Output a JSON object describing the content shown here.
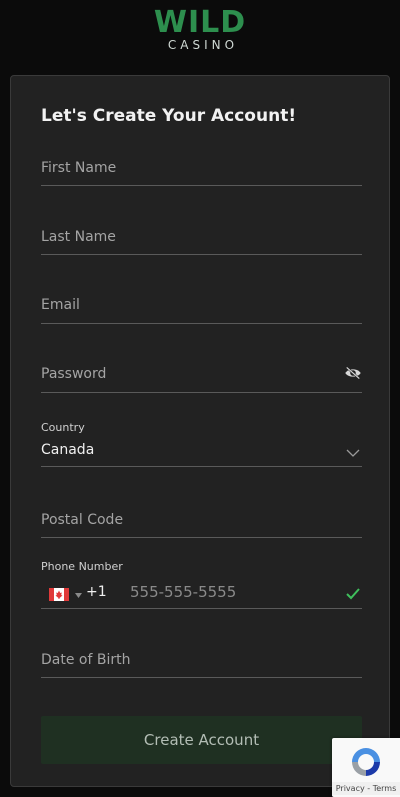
{
  "brand": {
    "name": "WILD",
    "sub": "CASINO",
    "color": "#2d8f4e"
  },
  "form": {
    "title": "Let's Create Your Account!",
    "first_name_placeholder": "First Name",
    "last_name_placeholder": "Last Name",
    "email_placeholder": "Email",
    "password_placeholder": "Password",
    "country_label": "Country",
    "country_value": "Canada",
    "postal_placeholder": "Postal Code",
    "phone_label": "Phone Number",
    "phone_code": "+1",
    "phone_placeholder": "555-555-5555",
    "dob_placeholder": "Date of Birth",
    "submit_label": "Create Account"
  },
  "recaptcha": {
    "privacy": "Privacy",
    "separator": " - ",
    "terms": "Terms"
  }
}
